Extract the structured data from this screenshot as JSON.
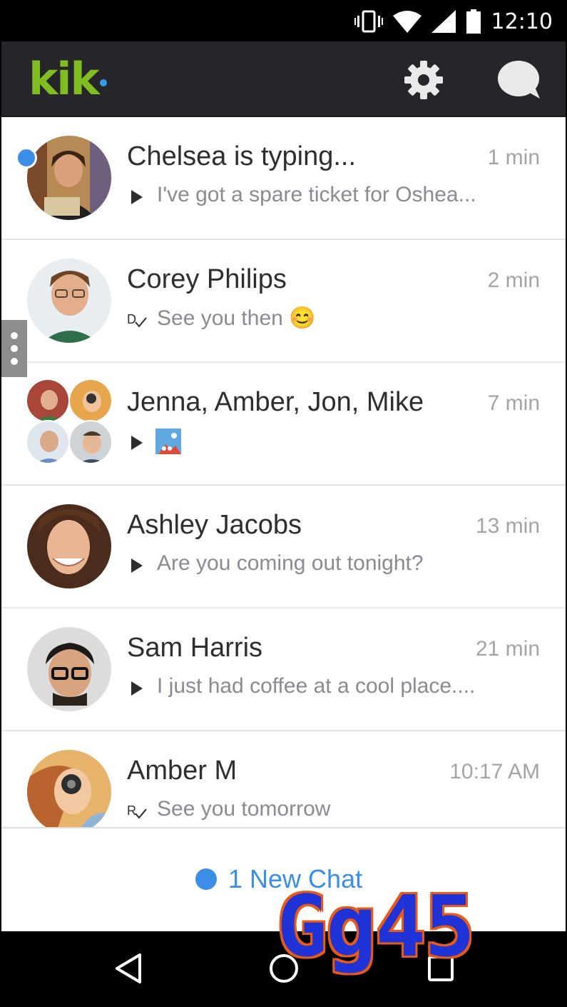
{
  "status_bar": {
    "time": "12:10",
    "icons": [
      "vibrate-icon",
      "wifi-icon",
      "signal-icon",
      "battery-icon"
    ]
  },
  "app_bar": {
    "logo": "kik",
    "brand_color": "#82bc23",
    "dot_color": "#3a9ae6",
    "settings_icon": "gear-icon",
    "compose_icon": "chat-bubble-icon"
  },
  "chats": [
    {
      "name": "Chelsea is typing...",
      "time": "1 min",
      "preview": "I've got a spare ticket for Oshea...",
      "status_icon": "play-icon",
      "unread": true
    },
    {
      "name": "Corey Philips",
      "time": "2 min",
      "preview": "See you then 😊",
      "status_icon": "delivered-icon"
    },
    {
      "name": "Jenna, Amber, Jon, Mike",
      "time": "7 min",
      "preview": "",
      "status_icon": "play-icon",
      "attachment": "image-thumbnail"
    },
    {
      "name": "Ashley Jacobs",
      "time": "13 min",
      "preview": "Are you coming out tonight?",
      "status_icon": "play-icon"
    },
    {
      "name": "Sam Harris",
      "time": "21 min",
      "preview": "I just had coffee at a cool place....",
      "status_icon": "play-icon"
    },
    {
      "name": "Amber M",
      "time": "10:17 AM",
      "preview": "See you tomorrow",
      "status_icon": "read-icon"
    }
  ],
  "new_chat": {
    "label": "1 New Chat",
    "color": "#3a8ee6"
  },
  "watermark": "Gg45",
  "nav": [
    "back-icon",
    "home-icon",
    "recents-icon"
  ]
}
